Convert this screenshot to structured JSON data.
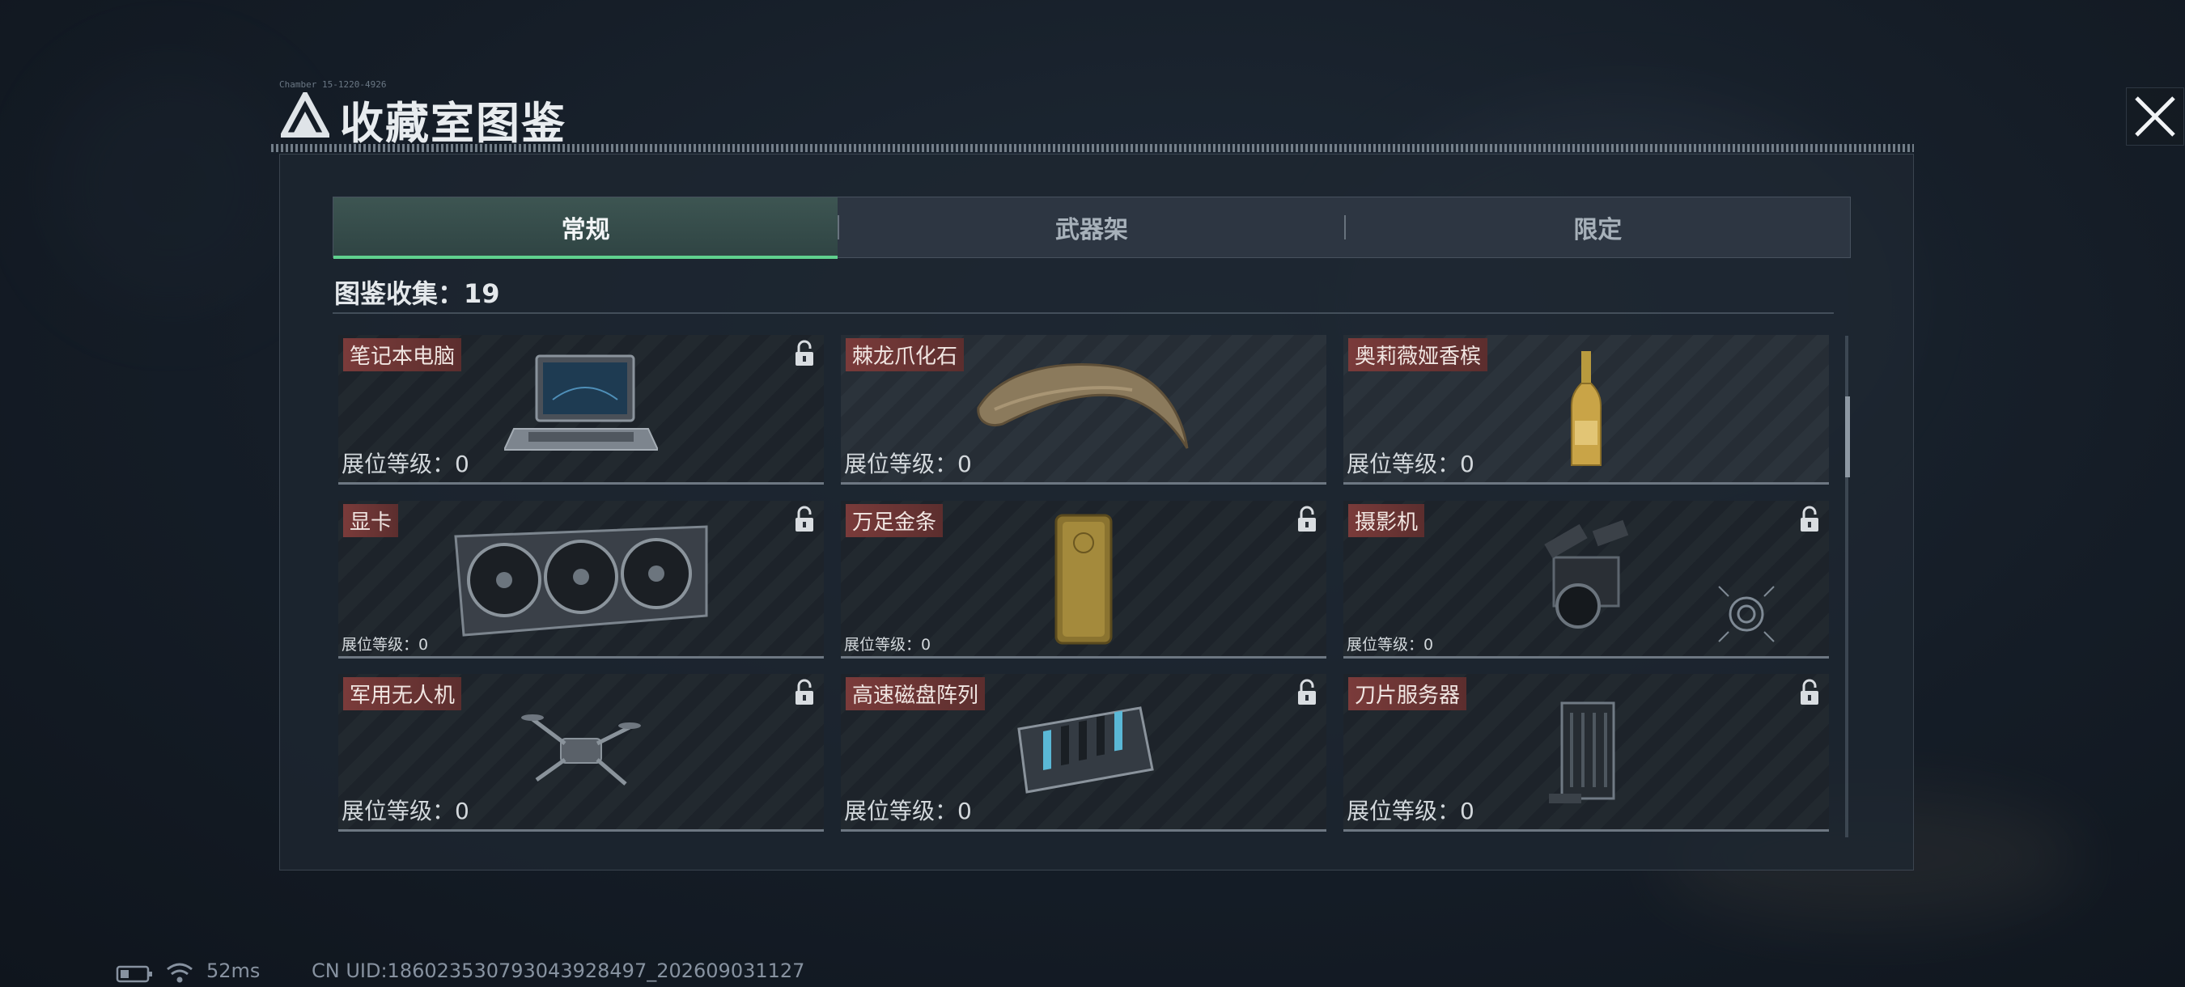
{
  "header": {
    "title": "收藏室图鉴",
    "small_text": "Chamber 15-1220-4926"
  },
  "tabs": [
    "常规",
    "武器架",
    "限定"
  ],
  "collection": {
    "label": "图鉴收集：",
    "count": "19"
  },
  "items": [
    {
      "name": "笔记本电脑",
      "level": "展位等级：0",
      "icon": "laptop-icon"
    },
    {
      "name": "棘龙爪化石",
      "level": "展位等级：0",
      "icon": "claw-fossil-icon"
    },
    {
      "name": "奥莉薇娅香槟",
      "level": "展位等级：0",
      "icon": "champagne-bottle-icon"
    },
    {
      "name": "显卡",
      "level": "展位等级：0",
      "icon": "graphics-card-icon"
    },
    {
      "name": "万足金条",
      "level": "展位等级：0",
      "icon": "gold-bar-icon"
    },
    {
      "name": "摄影机",
      "level": "展位等级：0",
      "icon": "camera-icon"
    },
    {
      "name": "军用无人机",
      "level": "展位等级：0",
      "icon": "drone-icon"
    },
    {
      "name": "高速磁盘阵列",
      "level": "展位等级：0",
      "icon": "disk-array-icon"
    },
    {
      "name": "刀片服务器",
      "level": "展位等级：0",
      "icon": "blade-server-icon"
    }
  ],
  "status": {
    "ping": "52ms",
    "uid": "CN UID:186023530793043928497_202609031127"
  },
  "colors": {
    "accent_green": "#5fd18e",
    "label_red": "#7a3b3a",
    "panel": "#1e2731"
  }
}
